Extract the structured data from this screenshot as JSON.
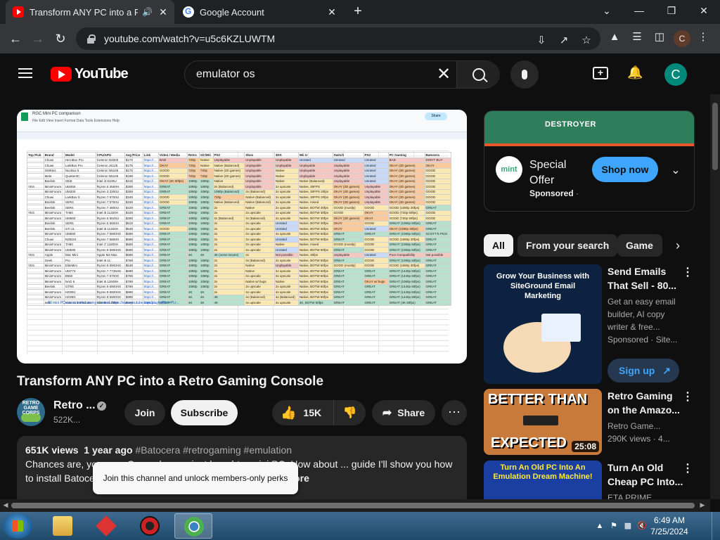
{
  "browser": {
    "tabs": [
      {
        "title": "Transform ANY PC into a Re",
        "favicon": "youtube-icon",
        "active": true,
        "audio_icon": "speaker-icon"
      },
      {
        "title": "Google Account",
        "favicon": "google-icon",
        "active": false
      }
    ],
    "url": "youtube.com/watch?v=u5c6KZLUWTM",
    "profile_initial": "C"
  },
  "youtube": {
    "logo_text": "YouTube",
    "search": {
      "value": "emulator os",
      "placeholder": "Search"
    },
    "avatar_initial": "C"
  },
  "video": {
    "title": "Transform ANY PC into a Retro Gaming Console",
    "channel": {
      "name": "Retro ...",
      "subscribers": "522K...",
      "avatar_text": "RETRO GAME CORPS"
    },
    "join_label": "Join",
    "subscribe_label": "Subscribe",
    "likes": "15K",
    "share_label": "Share",
    "description": {
      "views": "651K views",
      "age": "1 year ago",
      "tags": "#Batocera #retrogaming #emulation",
      "text": "Chances are, you ... e.  Or maybe you just bought a mini PC.  How about ... guide I'll show you how to install Batocera, a Lin... e any PC a console-like experi",
      "more": "...more"
    },
    "tooltip": "Join this channel and unlock members-only perks"
  },
  "spreadsheet": {
    "title": "RGC Mini PC comparison",
    "menu": "File  Edit  View  Insert  Format  Data  Tools  Extensions  Help",
    "share": "Share",
    "headers": [
      "Top Pick",
      "Brand",
      "Model",
      "CPU/APU",
      "Avg Price",
      "Link",
      "Video / Media",
      "Retro",
      "GC/Wii",
      "PS2",
      "Xbox",
      "3DS",
      "Wii U",
      "Switch",
      "PS3",
      "PC Gaming",
      "Batocera"
    ],
    "rows": [
      [
        "",
        "Chuwi",
        "HeroBox Pro",
        "Celeron N4500",
        "$170",
        "https://...",
        "BAD",
        "720p",
        "Native",
        "Unplayable",
        "Unplayable",
        "Unplayable",
        "Unrated",
        "Unrated",
        "Unrated",
        "BAD",
        "DON'T BUY"
      ],
      [
        "",
        "Chuwi",
        "LarkBox Pro",
        "Celeron J4125",
        "$175",
        "https://...",
        "OKAY",
        "720p",
        "Native",
        "Native (Balanced)",
        "Unplayable",
        "Unplayable",
        "Unplayable",
        "Unplayable",
        "Unrated",
        "OKAY (2D games)",
        "OKAY"
      ],
      [
        "",
        "GMKtec",
        "NucBox 5",
        "Celeron N5105",
        "$175",
        "https://...",
        "GOOD",
        "720p",
        "720p",
        "Native (2D games)",
        "Unplayable",
        "Native",
        "Unplayable",
        "Unplayable",
        "Unrated",
        "OKAY (2D games)",
        "GOOD"
      ],
      [
        "",
        "Mele",
        "Quieter3C",
        "Celeron N5105",
        "$199",
        "https://...",
        "GOOD",
        "720p",
        "720p",
        "Native (2D games)",
        "Unplayable",
        "Native",
        "Unplayable",
        "Unplayable",
        "Unrated",
        "OKAY (2D games)",
        "GOOD"
      ],
      [
        "",
        "Beelink",
        "SEi8",
        "Intel i3 8109U",
        "$215",
        "https://...",
        "OKAY (4K 60fps)",
        "1080p",
        "1080p",
        "Native",
        "Unplayable",
        "Native",
        "Native (Balanced)",
        "Unplayable",
        "Unrated",
        "OKAY (2D games)",
        "GOOD"
      ],
      [
        "YES",
        "MinisForum",
        "UM350",
        "Ryzen 5 3550H",
        "$309",
        "https://...",
        "GREAT",
        "1080p",
        "1080p",
        "2x (Balanced)",
        "Unplayable",
        "2x upscale",
        "Native, 30FPS",
        "OKAY (2D games)",
        "Unplayable",
        "OKAY (2D games)",
        "GOOD"
      ],
      [
        "",
        "MinisForum",
        "UM300",
        "Ryzen 3 3300U",
        "$309",
        "https://...",
        "GREAT",
        "1080p",
        "1080p",
        "1080p (Balanced)",
        "2x (Balanced)",
        "2x upscale",
        "Native, 30FPS 20fps",
        "OKAY (2D games)",
        "Unplayable",
        "OKAY (2D games)",
        "GOOD"
      ],
      [
        "",
        "Chuwi",
        "LarkBox X",
        "Ryzen 7 5700U",
        "$349",
        "https://...",
        "GOOD",
        "1080p",
        "1080p",
        "720p",
        "Native (Balanced)",
        "2x upscale",
        "Native, 30FPS 20fps",
        "OKAY (2D games)",
        "Unplayable",
        "OKAY (2D games)",
        "GOOD"
      ],
      [
        "",
        "Beelink",
        "SER3",
        "Ryzen 7 5750U",
        "$349",
        "https://...",
        "GOOD",
        "1080p",
        "1080p",
        "Native (Balanced)",
        "Native (Balanced)",
        "2x upscale",
        "Native, mixed",
        "OKAY (2D games)",
        "Unplayable",
        "OKAY (2D games)",
        "GOOD"
      ],
      [
        "",
        "Beelink",
        "SER4",
        "Ryzen 7 4800U",
        "$429",
        "https://...",
        "GREAT",
        "1080p",
        "1080p",
        "2x",
        "Native",
        "2x upscale",
        "Native, BOTW 30fps",
        "GOOD (mostly)",
        "GOOD",
        "GOOD (1080p 30fps)",
        "GREAT"
      ],
      [
        "YES",
        "MinisForum",
        "TH50",
        "Intel i5 11320H",
        "$429",
        "https://...",
        "GREAT",
        "1080p",
        "1080p",
        "2x",
        "2x upscale",
        "2x upscale",
        "Native, BOTW 30fps",
        "GOOD",
        "OKAY",
        "GOOD (720p 60fps)",
        "GOOD"
      ],
      [
        "",
        "MinisForum",
        "UM560",
        "Ryzen 5 5625U",
        "$459",
        "https://...",
        "GREAT",
        "1080p",
        "1080p",
        "2x (Balanced)",
        "2x (Balanced)",
        "2x upscale",
        "Native, BOTW 30fps",
        "OKAY (2D games)",
        "OKAY",
        "GOOD (720p 60fps)",
        "GOOD"
      ],
      [
        "",
        "Beelink",
        "SER5",
        "Ryzen 5 5600H",
        "$519",
        "https://...",
        "GREAT",
        "1080p",
        "1080p",
        "2x",
        "2x upscale",
        "Unrated",
        "Native, BOTW 30fps",
        "OKAY",
        "GOOD",
        "GREAT (1080p 60fps)",
        "GREAT"
      ],
      [
        "",
        "Beelink",
        "GTi 11",
        "Intel i5 11320H",
        "$549",
        "https://...",
        "GOOD",
        "1080p",
        "1080p",
        "2x",
        "2x upscale",
        "Unrated",
        "Native, BOTW 30fps",
        "OKAY",
        "Unrated",
        "OKAY (1080p 30fps)",
        "GREAT"
      ],
      [
        "",
        "MinisForum",
        "UM690",
        "Ryzen 7 6900HX",
        "$599",
        "https://...",
        "GREAT",
        "1080p",
        "1080p",
        "2x",
        "2x upscale",
        "4x upscale",
        "Native, BOTW 60fps",
        "GREAT",
        "GREAT",
        "GREAT (1080p 60fps)",
        "SCOTT'S PICK"
      ],
      [
        "",
        "Chuwi",
        "RZBOX",
        "Ryzen 7 5800H",
        "$599",
        "https://...",
        "GREAT",
        "1080p",
        "1080p",
        "2x",
        "2x upscale",
        "Unrated",
        "Native, BOTW 60fps",
        "GREAT",
        "GOOD",
        "GOOD (1080p 30fps)",
        "GREAT"
      ],
      [
        "",
        "MinisForum",
        "TH80",
        "Intel i7 11800H",
        "$659",
        "https://...",
        "GREAT",
        "1080p",
        "1080p",
        "2x",
        "2x upscale",
        "Native",
        "Native, mixed",
        "GOOD (mostly)",
        "GOOD",
        "GREAT (1080p 60fps)",
        "GREAT"
      ],
      [
        "",
        "MinisForum",
        "UM590",
        "Ryzen 9 5900HX",
        "$699",
        "https://...",
        "GREAT",
        "1080p",
        "1080p",
        "2x",
        "2x upscale",
        "Unrated",
        "Native, BOTW 60fps",
        "GREAT",
        "GOOD",
        "GREAT (1080p 60fps)",
        "GREAT"
      ],
      [
        "YES",
        "Apple",
        "Mac Mini",
        "Apple M2 Max",
        "$599",
        "https://...",
        "GREAT",
        "4K",
        "4K",
        "4K (some issues)",
        "2x",
        "Not possible",
        "Native, 30fps",
        "Unplayable",
        "Unrated",
        "Poor Compatibility",
        "Not possible"
      ],
      [
        "",
        "Geek",
        "Pro",
        "Intel i5 11",
        "$759",
        "https://...",
        "GREAT",
        "1080p",
        "1080p",
        "2x",
        "2x (Balanced)",
        "2x upscale",
        "Native, BOTW 60fps",
        "GREAT",
        "GOOD",
        "GREAT (1080p 60fps)",
        "GREAT"
      ],
      [
        "YES",
        "MinisForum",
        "EliteMini",
        "Ryzen 9 6900HX",
        "$649",
        "https://...",
        "GREAT",
        "1080p",
        "1080p",
        "2x",
        "Native",
        "Unplayable",
        "Native, BOTW 60fps",
        "GOOD (mostly)",
        "GOOD",
        "GOOD (1080p 30fps)",
        "GREAT"
      ],
      [
        "",
        "MinisForum",
        "UM773",
        "Ryzen 7 7735HS",
        "$699",
        "https://...",
        "GREAT",
        "1080p",
        "1080p",
        "2x",
        "Native",
        "2x upscale",
        "Native, BOTW 60fps",
        "GREAT",
        "GREAT",
        "GREAT (1440p 60fps)",
        "GREAT"
      ],
      [
        "",
        "MinisForum",
        "B550",
        "Ryzen 7 5700G",
        "$759",
        "https://...",
        "GREAT",
        "1080p",
        "1080p",
        "2x",
        "2x upscale",
        "2x upscale",
        "Native, BOTW 60fps",
        "GREAT",
        "GREAT",
        "GREAT (1440p 60fps)",
        "GREAT"
      ],
      [
        "",
        "MinisForum",
        "NAD 6",
        "Intel i5 12600H",
        "$799",
        "https://...",
        "GREAT",
        "1080p",
        "1080p",
        "2x",
        "Native w/ bugs",
        "Native",
        "Native, BOTW 60fps",
        "GREAT",
        "OKAY w/ bugs",
        "GREAT (1080p 60fps)",
        "GREAT"
      ],
      [
        "",
        "Beelink",
        "GTR6",
        "Ryzen 9 6900HX",
        "$799",
        "https://...",
        "GREAT",
        "1080p",
        "1080p",
        "2x",
        "2x upscale",
        "2x upscale",
        "Native, BOTW 60fps",
        "GREAT",
        "GREAT",
        "GREAT (1440p 60fps)",
        "GREAT"
      ],
      [
        "",
        "MinisForum",
        "HX90G",
        "Ryzen 9 6900HX",
        "$899",
        "https://...",
        "GREAT",
        "4K",
        "4K",
        "2x",
        "4x upscale",
        "4x upscale",
        "Native, BOTW 60fps",
        "GREAT",
        "GREAT",
        "GREAT (1440p 60fps)",
        "GREAT"
      ],
      [
        "",
        "MinisForum",
        "HX99G",
        "Ryzen 9 6900HX",
        "$999",
        "https://...",
        "GREAT",
        "4K",
        "4K",
        "4K",
        "4x (Balanced)",
        "4x (Balanced)",
        "Native, BOTW 60fps",
        "GREAT",
        "GREAT",
        "GREAT (1440p 60fps)",
        "GREAT"
      ],
      [
        "",
        "Intel",
        "NUC 11 Enthusiast",
        "Intel i5 11400H",
        "$999",
        "https://...",
        "GREAT",
        "4K",
        "4K",
        "4K",
        "4x upscale",
        "4x upscale",
        "4K, BOTW 60fps",
        "GREAT",
        "GREAT",
        "GREAT (4K 60fps)",
        "GREAT"
      ]
    ],
    "footnote": "All mini PCs were tested on my channel: https://www.youtube.com/playlist?list=PLr..."
  },
  "ad": {
    "banner_text": "DESTROYER",
    "logo_text": "mint",
    "title": "Special Offer",
    "sponsored": "Sponsored",
    "sponsored_sep": "·",
    "cta": "Shop now"
  },
  "chips": [
    "All",
    "From your search",
    "Game"
  ],
  "recommendations": [
    {
      "title": "Send Emails That Sell - 80...",
      "line1": "Get an easy email builder, AI copy writer & free...",
      "line2": "Sponsored · Site...",
      "thumb_text": "Grow Your Business with SiteGround Email Marketing",
      "cta": "Sign up"
    },
    {
      "title": "Retro Gaming on the Amazo...",
      "channel": "Retro Game...",
      "stats": "290K views · 4...",
      "thumb_text_top": "BETTER THAN",
      "thumb_text_bottom": "EXPECTED",
      "duration": "25:08"
    },
    {
      "title": "Turn An Old Cheap PC Into...",
      "channel": "ETA PRIME",
      "thumb_text": "Turn An Old PC Into An Emulation Dream Machine!"
    }
  ],
  "taskbar": {
    "time": "6:49 AM",
    "date": "7/25/2024"
  },
  "colors": {
    "yt_red": "#ff0000",
    "accent_blue": "#3ea6ff",
    "avatar_teal": "#00897b"
  }
}
